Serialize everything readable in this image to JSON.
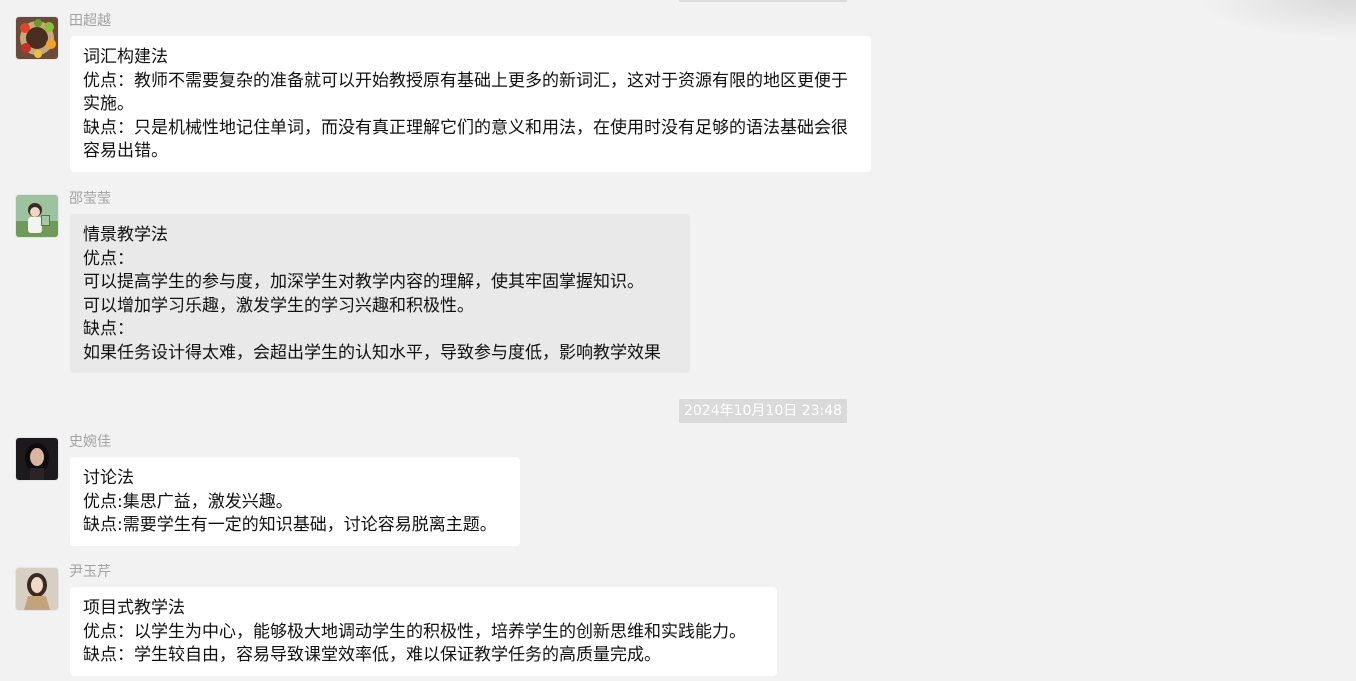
{
  "messages": [
    {
      "sender": "田超越",
      "avatar_icon": "fruit-bowl-avatar",
      "bubble_color": "#ffffff",
      "lines": [
        "词汇构建法",
        " 优点：教师不需要复杂的准备就可以开始教授原有基础上更多的新词汇，这对于资源有限的地区更便于实施。",
        "缺点：只是机械性地记住单词，而没有真正理解它们的意义和用法，在使用时没有足够的语法基础会很容易出错。"
      ]
    },
    {
      "sender": "邵莹莹",
      "avatar_icon": "girl-in-field-avatar",
      "bubble_color": "#e9e9e9",
      "lines": [
        "情景教学法",
        "优点：",
        "可以提高学生的参与度，加深学生对教学内容的理解，使其牢固掌握知识。",
        "可以增加学习乐趣，激发学生的学习兴趣和积极性。",
        "缺点：",
        "如果任务设计得太难，会超出学生的认知水平，导致参与度低，影响教学效果"
      ]
    },
    {
      "sender": "史婉佳",
      "avatar_icon": "dark-portrait-avatar",
      "bubble_color": "#ffffff",
      "lines": [
        "讨论法",
        "优点:集思广益，激发兴趣。",
        "缺点:需要学生有一定的知识基础，讨论容易脱离主题。"
      ]
    },
    {
      "sender": "尹玉芹",
      "avatar_icon": "portrait-avatar",
      "bubble_color": "#ffffff",
      "lines": [
        "项目式教学法",
        "优点：以学生为中心，能够极大地调动学生的积极性，培养学生的创新思维和实践能力。",
        "缺点：学生较自由，容易导致课堂效率低，难以保证教学任务的高质量完成。"
      ]
    }
  ],
  "timestamp": "2024年10月10日 23:48"
}
